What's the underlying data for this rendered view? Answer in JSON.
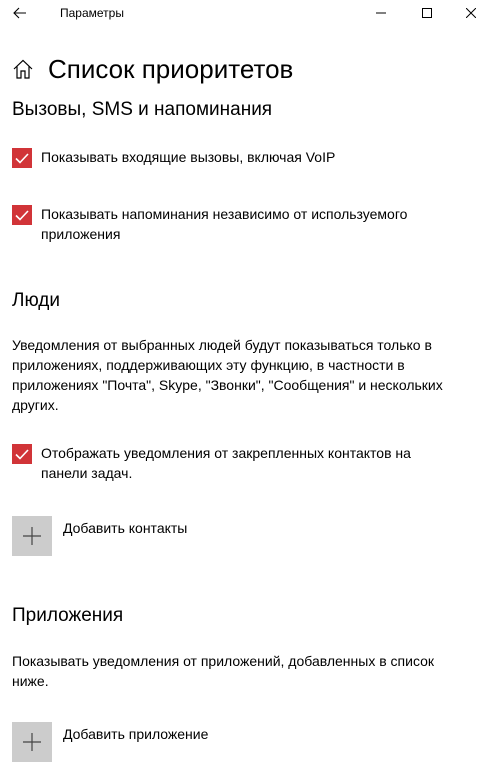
{
  "window": {
    "title": "Параметры"
  },
  "page": {
    "title": "Список приоритетов"
  },
  "sections": {
    "calls": {
      "title": "Вызовы, SMS и напоминания",
      "option_calls": "Показывать входящие вызовы, включая VoIP",
      "option_reminders": "Показывать напоминания независимо от используемого приложения"
    },
    "people": {
      "title": "Люди",
      "description": "Уведомления от выбранных людей будут показываться только в приложениях, поддерживающих эту функцию, в частности в приложениях \"Почта\", Skype, \"Звонки\", \"Сообщения\" и нескольких других.",
      "option_pinned": "Отображать уведомления от закрепленных контактов на панели задач.",
      "add_label": "Добавить контакты"
    },
    "apps": {
      "title": "Приложения",
      "description": "Показывать уведомления от приложений, добавленных в список ниже.",
      "add_label": "Добавить приложение"
    }
  },
  "checkbox_states": {
    "calls": true,
    "reminders": true,
    "pinned": true
  },
  "colors": {
    "accent": "#d13438",
    "tile": "#cccccc"
  }
}
